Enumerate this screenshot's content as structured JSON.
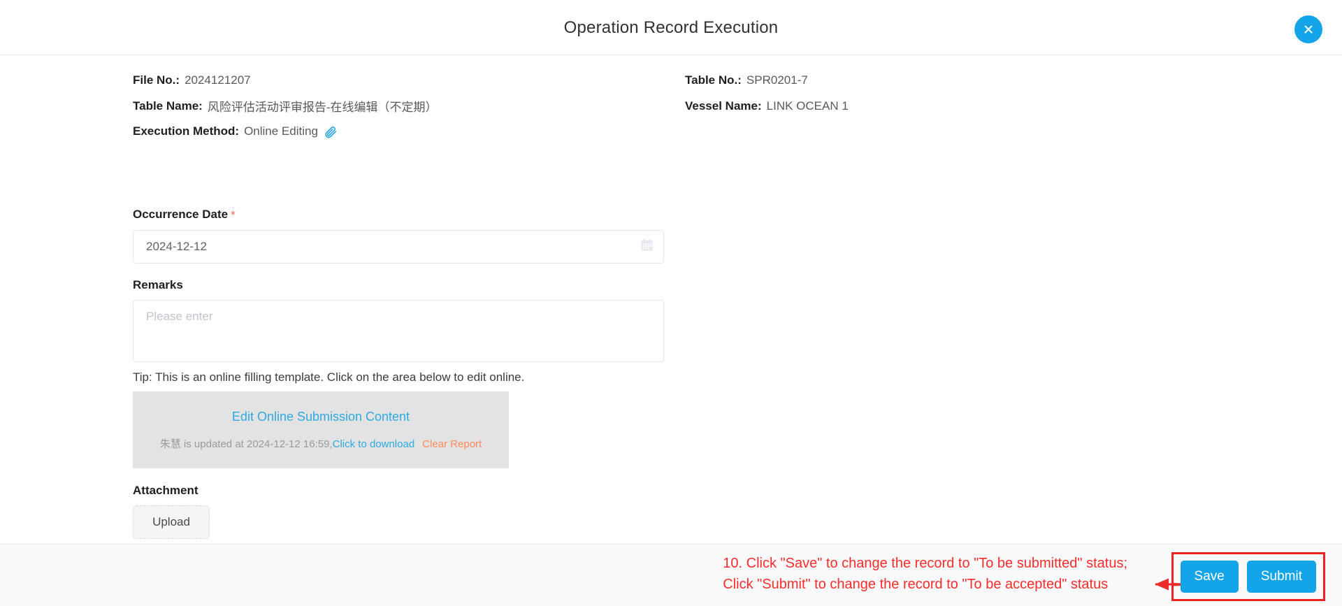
{
  "header": {
    "title": "Operation Record Execution",
    "close_icon": "close-icon"
  },
  "info": {
    "file_no_label": "File No.:",
    "file_no_value": "2024121207",
    "table_no_label": "Table No.:",
    "table_no_value": "SPR0201-7",
    "table_name_label": "Table Name:",
    "table_name_value": "风险评估活动评审报告-在线编辑（不定期）",
    "vessel_name_label": "Vessel Name:",
    "vessel_name_value": "LINK OCEAN 1",
    "execution_method_label": "Execution Method:",
    "execution_method_value": "Online Editing",
    "attachment_icon": "paperclip-icon"
  },
  "form": {
    "occurrence_date_label": "Occurrence Date",
    "occurrence_date_required": "*",
    "occurrence_date_value": "2024-12-12",
    "calendar_icon": "calendar-icon",
    "remarks_label": "Remarks",
    "remarks_value": "",
    "remarks_placeholder": "Please enter",
    "tip": "Tip: This is an online filling template. Click on the area below to edit online.",
    "attachment_label": "Attachment",
    "upload_button": "Upload"
  },
  "edit_panel": {
    "edit_link": "Edit Online Submission Content",
    "updated_by_text": "朱慧 is updated at 2024-12-12 16:59,",
    "download_link": "Click to download",
    "clear_link": "Clear Report"
  },
  "footer": {
    "annotation_line1": "10. Click \"Save\" to change the record to \"To be submitted\" status;",
    "annotation_line2": "Click \"Submit\" to change the record to \"To be accepted\" status",
    "save_label": "Save",
    "submit_label": "Submit"
  },
  "colors": {
    "accent_blue": "#13a5e8",
    "link_blue": "#2eaae0",
    "annotation_red": "#fb2c2c",
    "highlight_box_red": "#ee2222",
    "clear_orange": "#fd8b5c",
    "required_red": "#f56c6c",
    "panel_gray": "#e3e3e3",
    "footer_gray": "#fafafa"
  }
}
